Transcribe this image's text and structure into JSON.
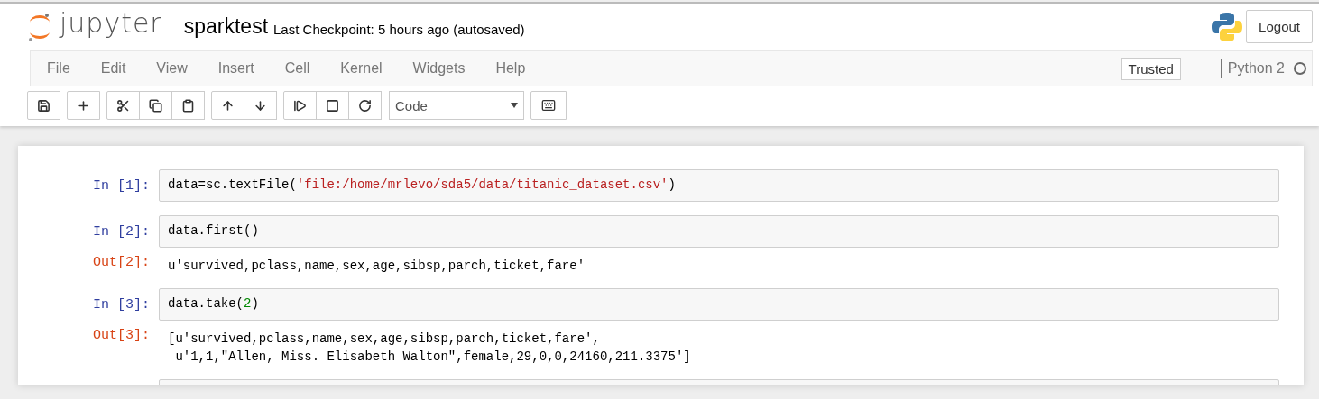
{
  "header": {
    "logo_text": "jupyter",
    "notebook_name": "sparktest",
    "checkpoint": "Last Checkpoint: 5 hours ago (autosaved)",
    "logout": "Logout"
  },
  "menu": {
    "items": [
      "File",
      "Edit",
      "View",
      "Insert",
      "Cell",
      "Kernel",
      "Widgets",
      "Help"
    ],
    "trusted": "Trusted",
    "kernel_name": "Python 2",
    "kernel_busy": false
  },
  "toolbar": {
    "cell_type": "Code"
  },
  "cells": [
    {
      "prompt": "In [1]:",
      "code": [
        {
          "text": "data=sc.textFile(",
          "kind": "plain"
        },
        {
          "text": "'file:/home/mrlevo/sda5/data/titanic_dataset.csv'",
          "kind": "string"
        },
        {
          "text": ")",
          "kind": "plain"
        }
      ]
    },
    {
      "prompt": "In [2]:",
      "code": [
        {
          "text": "data.first()",
          "kind": "plain"
        }
      ],
      "out_prompt": "Out[2]:",
      "output": [
        "u'survived,pclass,name,sex,age,sibsp,parch,ticket,fare'"
      ]
    },
    {
      "prompt": "In [3]:",
      "code": [
        {
          "text": "data.take(",
          "kind": "plain"
        },
        {
          "text": "2",
          "kind": "number"
        },
        {
          "text": ")",
          "kind": "plain"
        }
      ],
      "out_prompt": "Out[3]:",
      "output": [
        "[u'survived,pclass,name,sex,age,sibsp,parch,ticket,fare',",
        " u'1,1,\"Allen, Miss. Elisabeth Walton\",female,29,0,0,24160,211.3375']"
      ]
    }
  ]
}
